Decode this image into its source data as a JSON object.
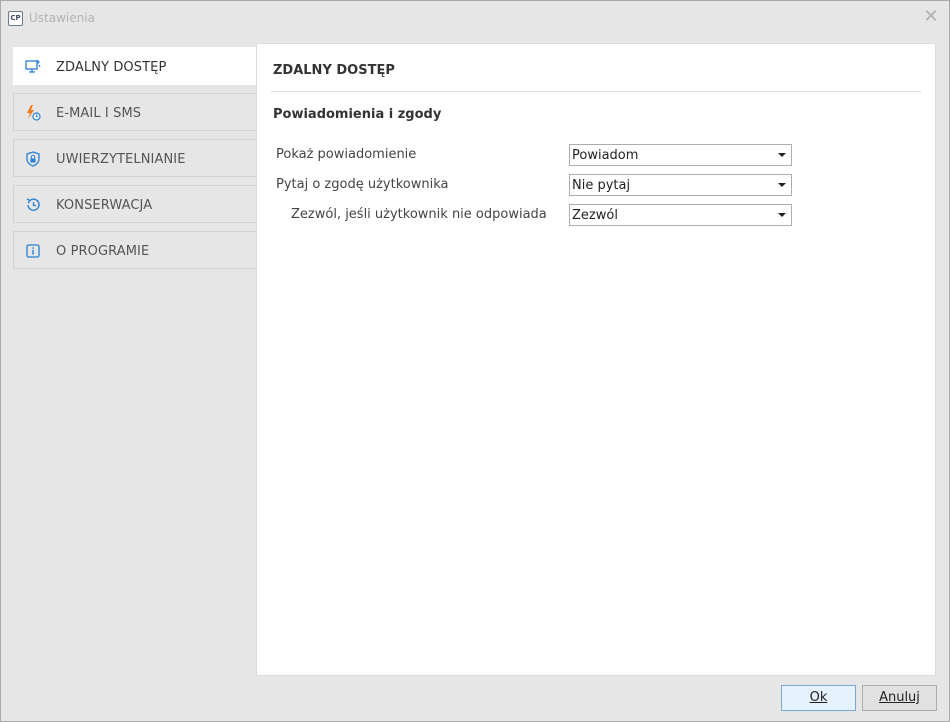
{
  "window": {
    "app_icon_text": "CP",
    "title": "Ustawienia",
    "close_glyph": "✕"
  },
  "sidebar": {
    "items": [
      {
        "label": "ZDALNY DOSTĘP",
        "icon": "remote-monitor-icon",
        "active": true
      },
      {
        "label": "E-MAIL I SMS",
        "icon": "bolt-clock-icon",
        "active": false
      },
      {
        "label": "UWIERZYTELNIANIE",
        "icon": "shield-lock-icon",
        "active": false
      },
      {
        "label": "KONSERWACJA",
        "icon": "history-icon",
        "active": false
      },
      {
        "label": "O PROGRAMIE",
        "icon": "info-icon",
        "active": false
      }
    ]
  },
  "main": {
    "page_title": "ZDALNY DOSTĘP",
    "section_title": "Powiadomienia i zgody",
    "rows": [
      {
        "label": "Pokaż powiadomienie",
        "value": "Powiadom"
      },
      {
        "label": "Pytaj o zgodę użytkownika",
        "value": "Nie pytaj"
      },
      {
        "label": "Zezwól, jeśli użytkownik nie odpowiada",
        "value": "Zezwól"
      }
    ]
  },
  "footer": {
    "ok_label": "Ok",
    "cancel_label": "Anuluj"
  },
  "colors": {
    "accent_blue": "#2a7fd4",
    "accent_orange": "#f07c1b",
    "window_bg": "#e6e6e6",
    "panel_bg": "#ffffff"
  }
}
